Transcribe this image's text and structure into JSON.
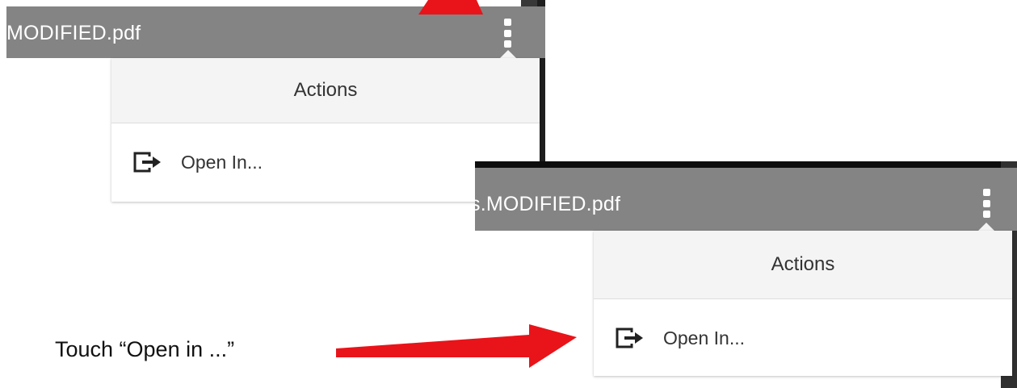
{
  "screenshot_top": {
    "filename": "MODIFIED.pdf",
    "menu": {
      "header": "Actions",
      "items": [
        {
          "label": "Open In...",
          "icon": "open-in-icon"
        }
      ]
    }
  },
  "screenshot_bottom": {
    "filename": "s.MODIFIED.pdf",
    "menu": {
      "header": "Actions",
      "items": [
        {
          "label": "Open In...",
          "icon": "open-in-icon"
        }
      ]
    }
  },
  "annotation": {
    "instruction": "Touch “Open in ...”",
    "arrow_color": "#e8141a"
  },
  "colors": {
    "titlebar": "#848484",
    "menu_header_bg": "#f4f4f4",
    "text": "#333333"
  }
}
